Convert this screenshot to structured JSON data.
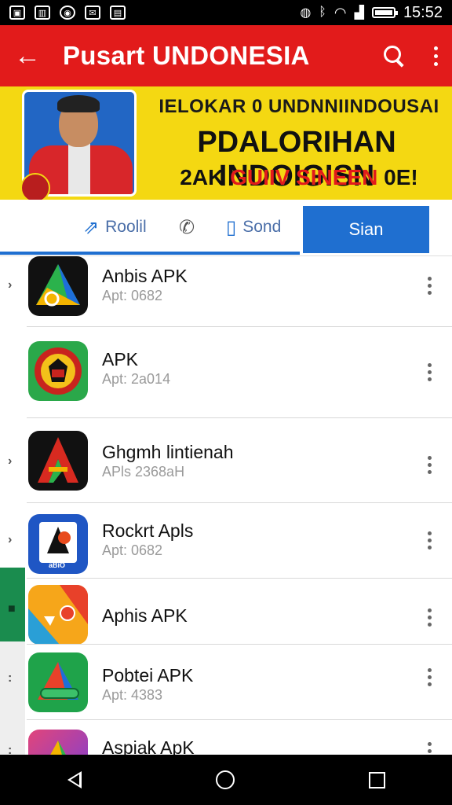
{
  "status_bar": {
    "time": "15:52",
    "left_icons": [
      "photo-icon",
      "chart-icon",
      "circle-icon",
      "mail-icon",
      "file-icon"
    ],
    "right_icons": [
      "vibrate-icon",
      "bluetooth-icon",
      "wifi-icon",
      "signal-icon",
      "battery-icon"
    ]
  },
  "app_bar": {
    "title": "Pusart UNDONESIA",
    "back_icon": "arrow-back-icon",
    "search_icon": "search-icon",
    "menu_icon": "more-vert-icon",
    "color": "#e21b1b"
  },
  "banner": {
    "line1": "IELOKAR 0 UNDNNIINDOUSAI",
    "line2": "PDALORIHAN INDOIGISN",
    "line3_a": "2AK ",
    "line3_b": "GUIIV SINEEN",
    "line3_c": " 0E!",
    "background": "#f4d812"
  },
  "tabs": [
    {
      "label": "Roolil",
      "icon": "share-icon"
    },
    {
      "label": "",
      "icon": "phone-icon"
    },
    {
      "label": "Sond",
      "icon": "clipboard-icon"
    },
    {
      "label": "Sian",
      "icon": "",
      "active": true
    }
  ],
  "apps": [
    {
      "name": "Anbis APK",
      "sub": "Apt: 0682"
    },
    {
      "name": "APK",
      "sub": "Apt: 2a014"
    },
    {
      "name": "Ghgmh lintienah",
      "sub": "APls 2368aH"
    },
    {
      "name": "Rockrt Apls",
      "sub": "Apt: 0682"
    },
    {
      "name": "Aphis APK",
      "sub": ""
    },
    {
      "name": "Pobtei APK",
      "sub": "Apt: 4383"
    },
    {
      "name": "Aspiak ApK",
      "sub": ""
    }
  ],
  "app_icon_badge": "aBiO",
  "colors": {
    "accent": "#1f6fd0",
    "side_green": "#1a8c4e"
  }
}
